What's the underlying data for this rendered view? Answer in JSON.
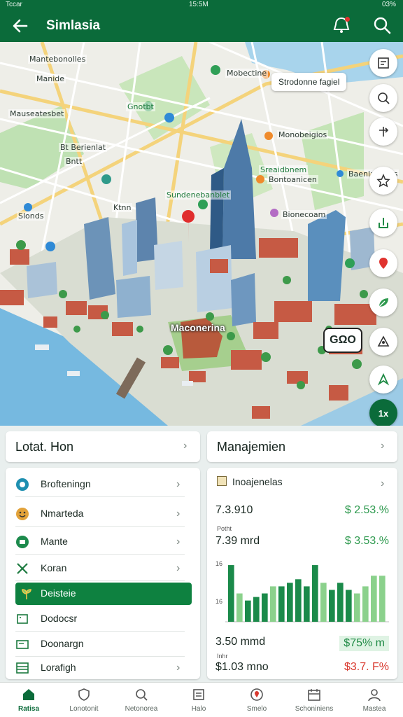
{
  "status_bar": {
    "left": "Tccar",
    "time": "15:5M",
    "battery": "03%"
  },
  "app_bar": {
    "title": "Simlasia",
    "back_icon": "arrow-left-icon",
    "alert_icon": "alert-icon",
    "search_icon": "search-icon"
  },
  "map": {
    "callout": "Strodonne fagiel",
    "center_label": "Maconerina",
    "badge": "GΩO",
    "labels": [
      "Mantebonolles",
      "Manide",
      "Mauseatesbet",
      "Mobectine",
      "Bt Berienlat",
      "Bntt",
      "Gnotbt",
      "Ktnn",
      "Monobeigios",
      "Sreaidbnem",
      "Slonds",
      "Bontoanicen",
      "Sundenebanblet",
      "Bionecoam",
      "Baenlaesaris"
    ],
    "tools": [
      "layers-icon",
      "zoom-icon",
      "route-icon",
      "star-icon",
      "share-icon",
      "pin-icon",
      "leaf-icon",
      "compass-icon",
      "navigate-icon"
    ],
    "zoom_value": "1x"
  },
  "location_card": {
    "title": "Lotat. Hon"
  },
  "management_card": {
    "title": "Manajemien"
  },
  "location_list": [
    {
      "label": "Brofteningn",
      "icon": "info-icon",
      "active": false
    },
    {
      "label": "Nmarteda",
      "icon": "face-icon",
      "active": false
    },
    {
      "label": "Mante",
      "icon": "camera-icon",
      "active": false
    },
    {
      "label": "Koran",
      "icon": "cross-icon",
      "active": false
    },
    {
      "label": "Deisteie",
      "icon": "plant-icon",
      "active": true
    },
    {
      "label": "Dodocsr",
      "icon": "card-icon",
      "active": false
    },
    {
      "label": "Doonargn",
      "icon": "document-icon",
      "active": false
    },
    {
      "label": "Lorafigh",
      "icon": "table-icon",
      "active": false
    }
  ],
  "management": {
    "header": "Inoajenelas",
    "rows": [
      {
        "value": "7.3.910",
        "pct": "$ 2.53.%",
        "pct_color": "#2f9a4f"
      },
      {
        "caption": "Potht",
        "value": "7.39 mrd",
        "pct": "$ 3.53.%",
        "pct_color": "#2f9a4f"
      },
      {
        "value": "3.50 mmd",
        "pct": "$75% m",
        "pct_color": "#1f8a45"
      },
      {
        "caption": "Inhr",
        "value": "$1.03 mno",
        "pct": "$3.7. F%",
        "pct_color": "#d93a30"
      }
    ],
    "axis_top": "16",
    "axis_mid": "16"
  },
  "chart_data": {
    "type": "bar",
    "values": [
      16,
      8,
      6,
      7,
      8,
      10,
      10,
      11,
      12,
      10,
      16,
      11,
      9,
      11,
      9,
      8,
      10,
      13,
      13
    ],
    "highlight": [
      false,
      true,
      false,
      false,
      false,
      true,
      false,
      false,
      false,
      false,
      false,
      true,
      false,
      false,
      false,
      true,
      true,
      true,
      true
    ],
    "ylim": [
      0,
      17
    ],
    "colors": {
      "base": "#1b8a4a",
      "light": "#8bd18c"
    }
  },
  "bottom_nav": [
    {
      "label": "Ratisa",
      "icon": "home-icon",
      "active": true
    },
    {
      "label": "Lonotonit",
      "icon": "shield-icon",
      "active": false
    },
    {
      "label": "Netonorea",
      "icon": "search-icon",
      "active": false
    },
    {
      "label": "Halo",
      "icon": "list-icon",
      "active": false
    },
    {
      "label": "Smelo",
      "icon": "pin-icon",
      "active": false
    },
    {
      "label": "Schoniniens",
      "icon": "calendar-icon",
      "active": false
    },
    {
      "label": "Mastea",
      "icon": "user-icon",
      "active": false
    }
  ]
}
